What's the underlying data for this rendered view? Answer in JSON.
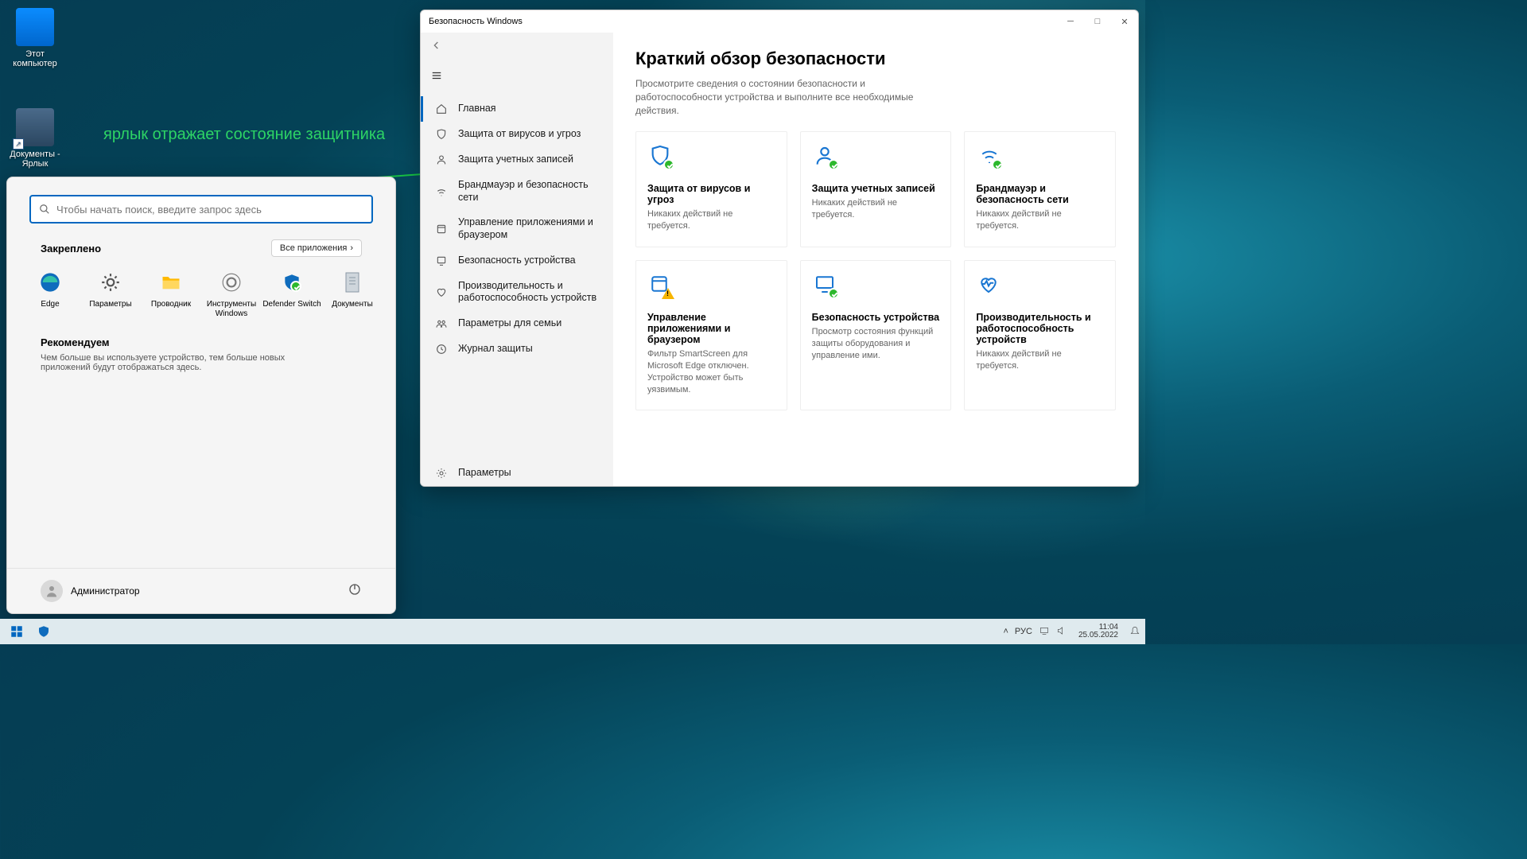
{
  "desktop": {
    "icons": [
      {
        "label": "Этот компьютер"
      },
      {
        "label": "Документы - Ярлык"
      }
    ]
  },
  "annotation": {
    "text": "ярлык отражает состояние защитника"
  },
  "start_menu": {
    "search_placeholder": "Чтобы начать поиск, введите запрос здесь",
    "pinned_header": "Закреплено",
    "all_apps": "Все приложения",
    "pins": [
      {
        "label": "Edge"
      },
      {
        "label": "Параметры"
      },
      {
        "label": "Проводник"
      },
      {
        "label": "Инструменты Windows"
      },
      {
        "label": "Defender Switch"
      },
      {
        "label": "Документы"
      }
    ],
    "recommended_header": "Рекомендуем",
    "recommended_text": "Чем больше вы используете устройство, тем больше новых приложений будут отображаться здесь.",
    "user": "Администратор"
  },
  "security_window": {
    "title": "Безопасность Windows",
    "nav": [
      {
        "label": "Главная",
        "icon": "home",
        "active": true
      },
      {
        "label": "Защита от вирусов и угроз",
        "icon": "shield"
      },
      {
        "label": "Защита учетных записей",
        "icon": "person"
      },
      {
        "label": "Брандмауэр и безопасность сети",
        "icon": "wifi"
      },
      {
        "label": "Управление приложениями и браузером",
        "icon": "app"
      },
      {
        "label": "Безопасность устройства",
        "icon": "device"
      },
      {
        "label": "Производительность и работоспособность устройств",
        "icon": "heart"
      },
      {
        "label": "Параметры для семьи",
        "icon": "family"
      },
      {
        "label": "Журнал защиты",
        "icon": "history"
      }
    ],
    "settings_label": "Параметры",
    "heading": "Краткий обзор безопасности",
    "lead": "Просмотрите сведения о состоянии безопасности и работоспособности устройства и выполните все необходимые действия.",
    "tiles": [
      {
        "title": "Защита от вирусов и угроз",
        "desc": "Никаких действий не требуется.",
        "icon": "shield",
        "status": "ok"
      },
      {
        "title": "Защита учетных записей",
        "desc": "Никаких действий не требуется.",
        "icon": "person",
        "status": "ok"
      },
      {
        "title": "Брандмауэр и безопасность сети",
        "desc": "Никаких действий не требуется.",
        "icon": "wifi",
        "status": "ok"
      },
      {
        "title": "Управление приложениями и браузером",
        "desc": "Фильтр SmartScreen для Microsoft Edge отключен. Устройство может быть уязвимым.",
        "icon": "app",
        "status": "warn"
      },
      {
        "title": "Безопасность устройства",
        "desc": "Просмотр состояния функций защиты оборудования и управление ими.",
        "icon": "device",
        "status": "ok"
      },
      {
        "title": "Производительность и работоспособность устройств",
        "desc": "Никаких действий не требуется.",
        "icon": "heart",
        "status": "none"
      }
    ]
  },
  "taskbar": {
    "lang": "РУС",
    "time": "11:04",
    "date": "25.05.2022"
  }
}
